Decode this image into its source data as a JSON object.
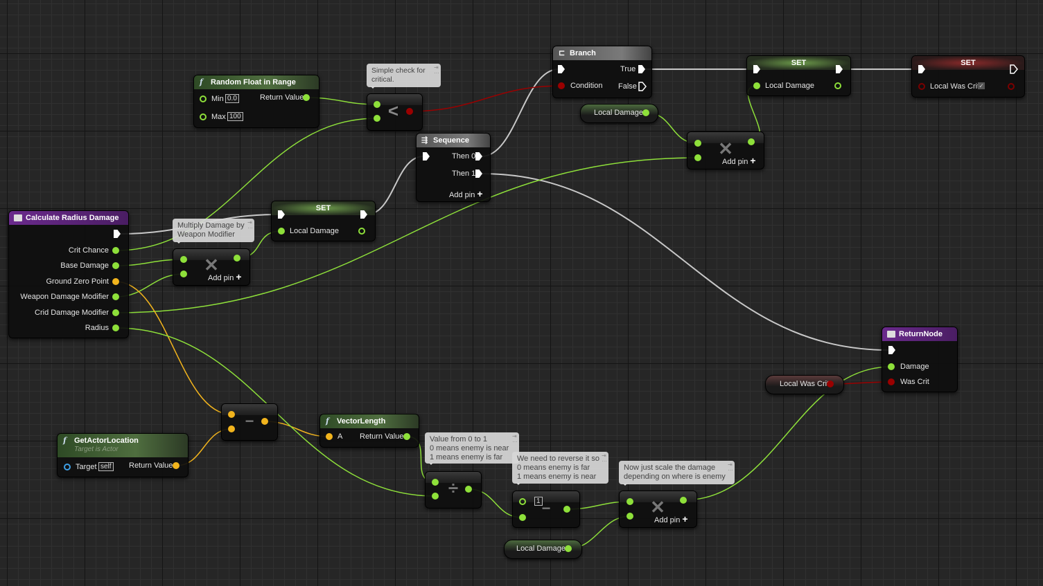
{
  "colors": {
    "float": "#8ee03a",
    "vector": "#f2b41d",
    "bool": "#9a0000",
    "object": "#3fa0e6",
    "exec": "#ffffff"
  },
  "entry": {
    "title": "Calculate Radius Damage",
    "outputs": [
      "Crit Chance",
      "Base Damage",
      "Ground Zero Point",
      "Weapon Damage Modifier",
      "Crid Damage Modifier",
      "Radius"
    ]
  },
  "random": {
    "title": "Random Float in Range",
    "min_label": "Min",
    "min": "0.0",
    "max_label": "Max",
    "max": "100",
    "ret": "Return Value"
  },
  "comments": {
    "crit": "Simple check for critical.",
    "mult": "Multiply Damage by Weapon Modifier",
    "value": "Value from 0 to 1\n0 means enemy is near\n1 means enemy is far",
    "reverse": "We need to reverse it so\n0 means enemy is far\n1 means enemy is near",
    "scale": "Now just scale the damage\ndepending on where is enemy"
  },
  "less": {
    "symbol": "<"
  },
  "branch": {
    "title": "Branch",
    "true": "True",
    "false": "False",
    "condition": "Condition"
  },
  "sequence": {
    "title": "Sequence",
    "then0": "Then 0",
    "then1": "Then 1",
    "add_pin": "Add pin"
  },
  "set1": {
    "title": "SET",
    "var": "Local Damage"
  },
  "set2": {
    "title": "SET",
    "var": "Local Damage"
  },
  "set3": {
    "title": "SET",
    "var": "Local Was Crit",
    "checked": true
  },
  "getters": {
    "ld1": "Local Damage",
    "ld2": "Local Damage",
    "crit": "Local Was Crit"
  },
  "multiply": {
    "symbol": "✕",
    "add_pin": "Add pin"
  },
  "subtract": {
    "symbol": "−"
  },
  "divide": {
    "symbol": "÷"
  },
  "reverse_sub": {
    "a_value": "1"
  },
  "return_node": {
    "title": "ReturnNode",
    "damage": "Damage",
    "was_crit": "Was Crit"
  },
  "get_actor": {
    "title": "GetActorLocation",
    "subtitle": "Target is Actor",
    "target": "Target",
    "target_value": "self",
    "ret": "Return Value"
  },
  "vector_length": {
    "title": "VectorLength",
    "a": "A",
    "ret": "Return Value"
  }
}
